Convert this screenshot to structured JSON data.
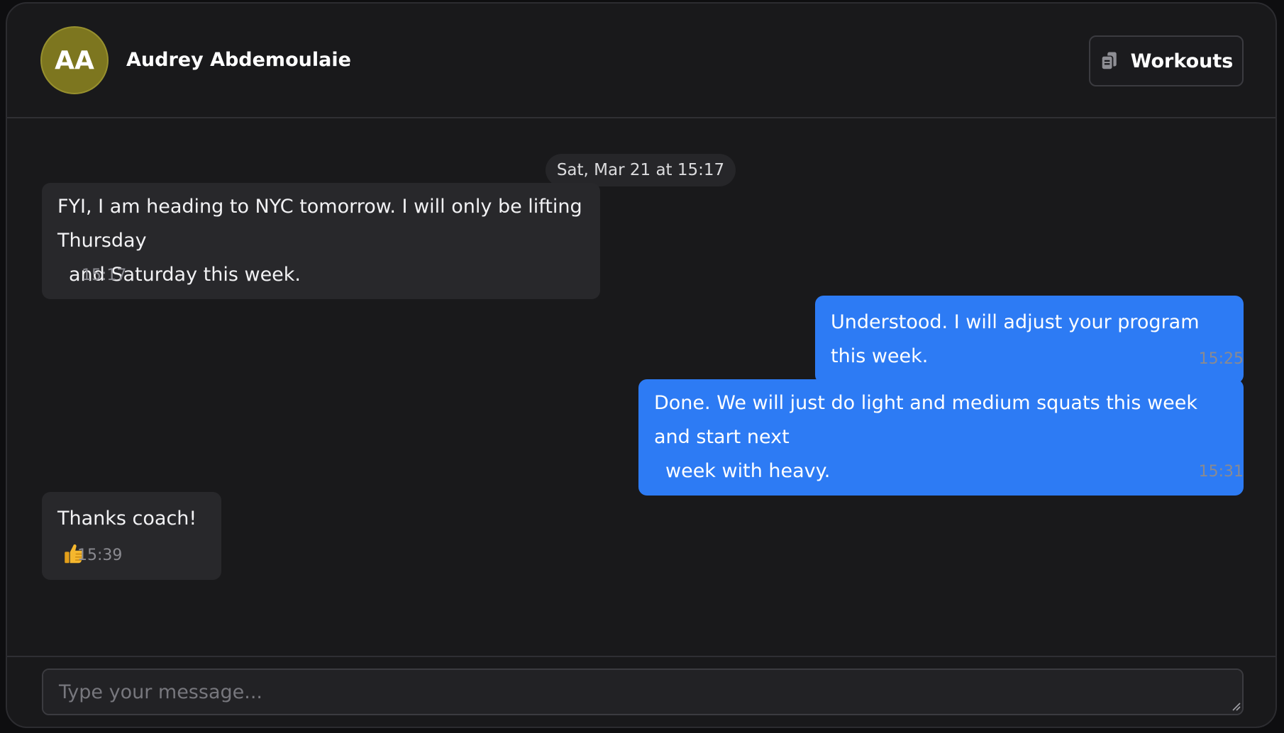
{
  "contact": {
    "initials": "AA",
    "name": "Audrey Abdemoulaie",
    "avatar_color": "#7d761f"
  },
  "header": {
    "workouts_label": "Workouts",
    "workouts_icon": "clipboard-copy-icon"
  },
  "thread": {
    "date_separator": "Sat, Mar 21 at 15:17",
    "messages": [
      {
        "direction": "incoming",
        "line1": "FYI, I am heading to NYC tomorrow. I will only be lifting Thursday",
        "line2": "and Saturday this week.",
        "time": "15:17"
      },
      {
        "direction": "outgoing",
        "line1": "Understood. I will adjust your program this week.",
        "time": "15:25"
      },
      {
        "direction": "outgoing",
        "line1": "Done. We will just do light and medium squats this week and start next",
        "line2": "week with heavy.",
        "time": "15:31"
      },
      {
        "direction": "incoming",
        "line1": "Thanks coach!",
        "emoji": "thumbs-up-emoji",
        "time": "15:39"
      }
    ]
  },
  "composer": {
    "placeholder": "Type your message...",
    "value": ""
  },
  "colors": {
    "background": "#19191b",
    "incoming_bubble": "#28282b",
    "outgoing_bubble": "#2d7bf4"
  }
}
